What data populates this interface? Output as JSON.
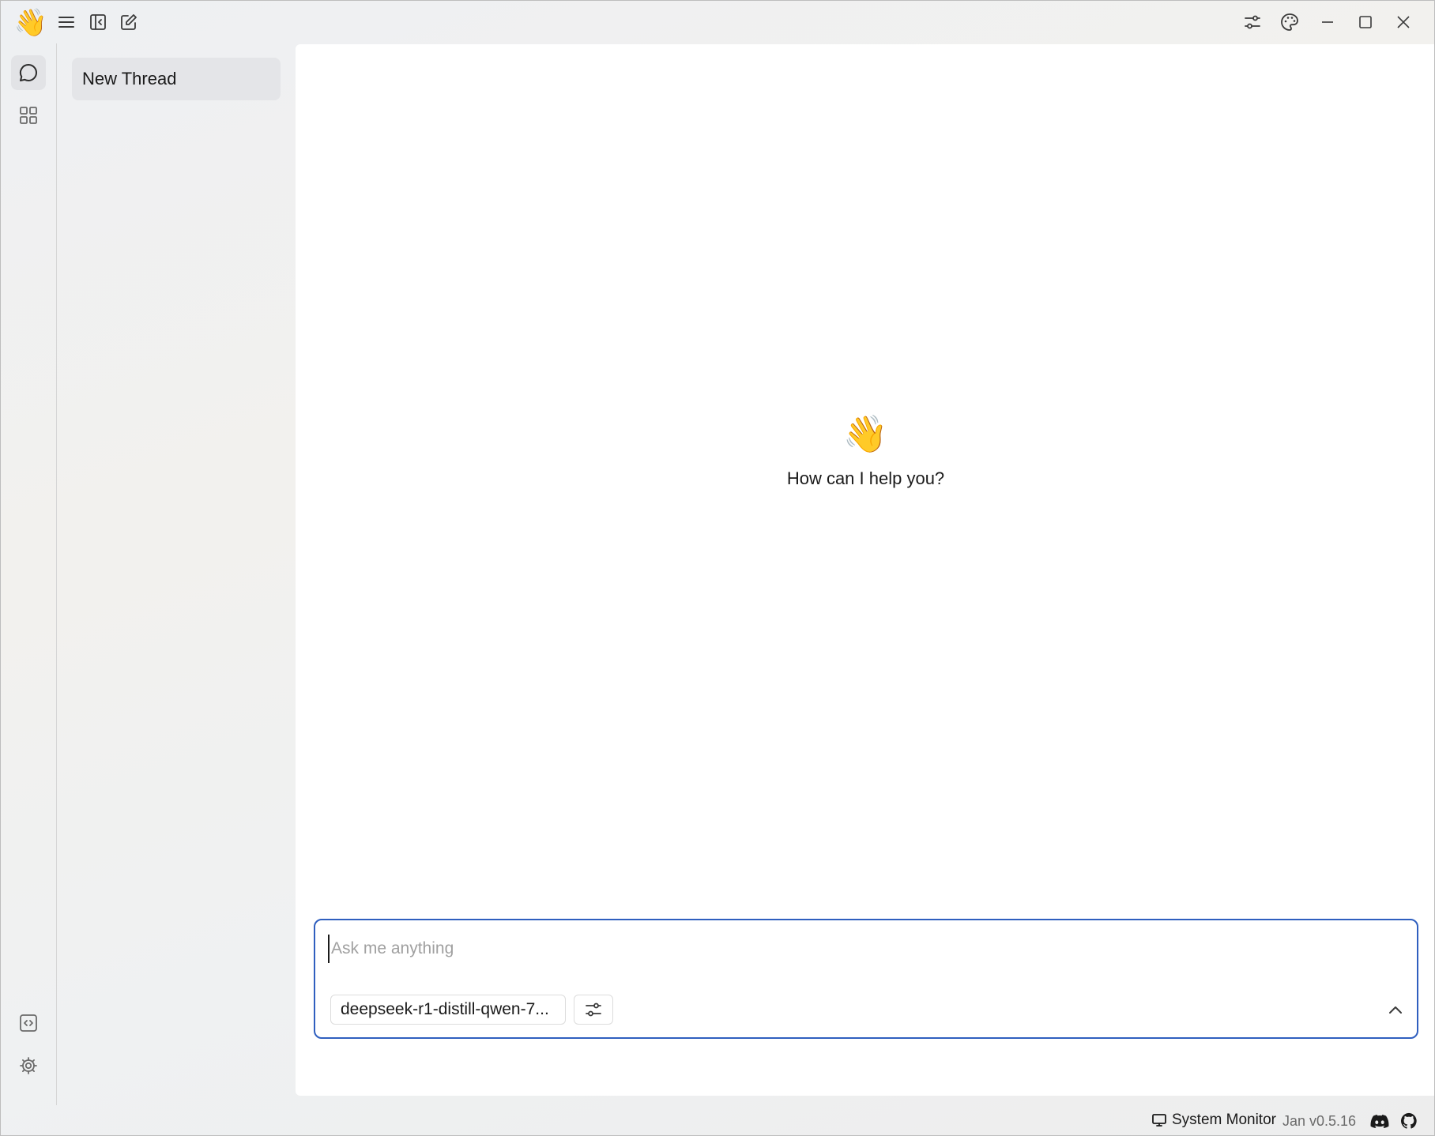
{
  "titlebar": {
    "logo_emoji": "👋",
    "icons": [
      "menu-icon",
      "collapse-sidebar-icon",
      "new-thread-icon",
      "sliders-icon",
      "palette-icon",
      "minimize-icon",
      "maximize-icon",
      "close-icon"
    ]
  },
  "rail": {
    "items": [
      {
        "name": "chat-icon",
        "active": true
      },
      {
        "name": "hub-grid-icon",
        "active": false
      }
    ],
    "bottom_items": [
      "code-icon",
      "settings-icon"
    ]
  },
  "threads": {
    "items": [
      {
        "label": "New Thread",
        "selected": true
      }
    ]
  },
  "main": {
    "welcome_emoji": "👋",
    "welcome_text": "How can I help you?"
  },
  "composer": {
    "placeholder": "Ask me anything",
    "value": "",
    "model_label": "deepseek-r1-distill-qwen-7...",
    "accent": "#2f5fbf"
  },
  "statusbar": {
    "monitor_label": "System Monitor",
    "version": "Jan v0.5.16",
    "icons": [
      "discord-icon",
      "github-icon"
    ]
  }
}
